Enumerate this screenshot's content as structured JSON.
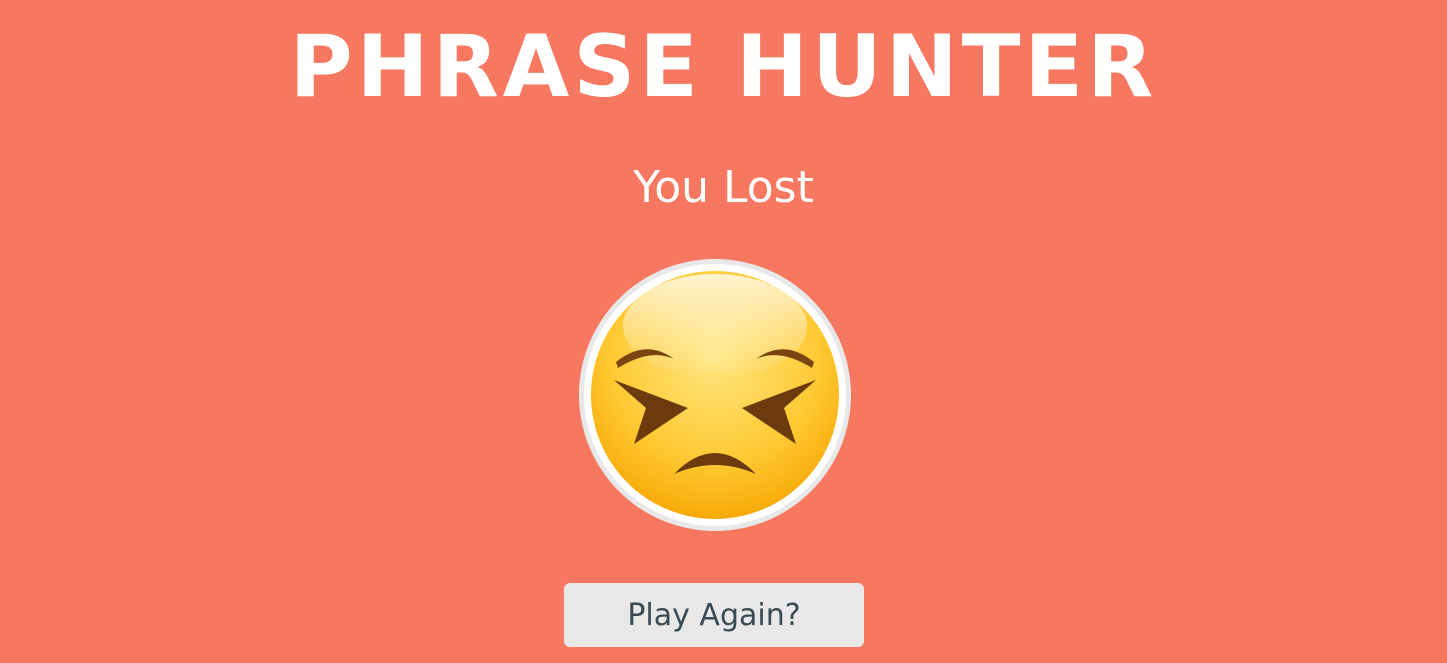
{
  "game": {
    "title": "PHRASE HUNTER",
    "result_message": "You Lost",
    "play_again_label": "Play Again?",
    "result_icon": "persevering-face-icon"
  },
  "colors": {
    "background": "#f67860",
    "title_text": "#ffffff",
    "button_background": "#e8e8e8",
    "button_text": "#3a4a52",
    "emoji_face_top": "#ffe08a",
    "emoji_face_bottom": "#ffb400"
  }
}
